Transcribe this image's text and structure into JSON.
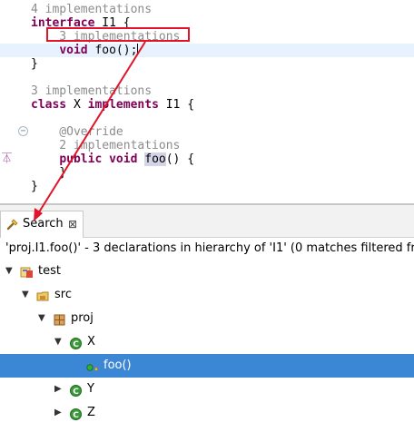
{
  "editor": {
    "lines": [
      {
        "parts": [
          {
            "t": "4 implementations",
            "c": "ann"
          }
        ]
      },
      {
        "parts": [
          {
            "t": "interface",
            "c": "kw"
          },
          {
            "t": " I1 {",
            "c": ""
          }
        ]
      },
      {
        "parts": [
          {
            "t": "    3 implementations",
            "c": "ann"
          }
        ]
      },
      {
        "parts": [
          {
            "t": "    ",
            "c": ""
          },
          {
            "t": "void",
            "c": "kw"
          },
          {
            "t": " foo();",
            "c": ""
          }
        ],
        "current": true
      },
      {
        "parts": [
          {
            "t": "}",
            "c": ""
          }
        ]
      },
      {
        "parts": [
          {
            "t": "",
            "c": ""
          }
        ]
      },
      {
        "parts": [
          {
            "t": "3 implementations",
            "c": "ann"
          }
        ]
      },
      {
        "parts": [
          {
            "t": "class",
            "c": "kw"
          },
          {
            "t": " X ",
            "c": ""
          },
          {
            "t": "implements",
            "c": "kw"
          },
          {
            "t": " I1 {",
            "c": ""
          }
        ]
      },
      {
        "parts": [
          {
            "t": "",
            "c": ""
          }
        ]
      },
      {
        "parts": [
          {
            "t": "    @Override",
            "c": "ann"
          }
        ]
      },
      {
        "parts": [
          {
            "t": "    2 implementations",
            "c": "ann"
          }
        ]
      },
      {
        "parts": [
          {
            "t": "    ",
            "c": ""
          },
          {
            "t": "public",
            "c": "kw"
          },
          {
            "t": " ",
            "c": ""
          },
          {
            "t": "void",
            "c": "kw"
          },
          {
            "t": " ",
            "c": ""
          },
          {
            "t": "foo",
            "c": "hlw"
          },
          {
            "t": "() {",
            "c": ""
          }
        ]
      },
      {
        "parts": [
          {
            "t": "    }",
            "c": ""
          }
        ]
      },
      {
        "parts": [
          {
            "t": "}",
            "c": ""
          }
        ]
      }
    ]
  },
  "search_view": {
    "tab_label": "Search",
    "close_glyph": "⊠",
    "summary": "'proj.I1.foo()' - 3 declarations in hierarchy of 'I1' (0 matches filtered from view)",
    "tree": [
      {
        "label": "test",
        "level": 0,
        "expanded": true,
        "icon": "project-icon"
      },
      {
        "label": "src",
        "level": 1,
        "expanded": true,
        "icon": "source-folder-icon"
      },
      {
        "label": "proj",
        "level": 2,
        "expanded": true,
        "icon": "package-icon"
      },
      {
        "label": "X",
        "level": 3,
        "expanded": true,
        "icon": "class-icon"
      },
      {
        "label": "foo()",
        "level": 4,
        "expanded": null,
        "icon": "method-icon",
        "selected": true
      },
      {
        "label": "Y",
        "level": 3,
        "expanded": false,
        "icon": "class-icon"
      },
      {
        "label": "Z",
        "level": 3,
        "expanded": false,
        "icon": "class-icon"
      }
    ]
  },
  "colors": {
    "keyword": "#7f0055",
    "annotation_text": "#8c8c8c",
    "selection": "#3c86d6",
    "highlight_box": "#e0142a",
    "class_icon": "#3a9a3a"
  }
}
